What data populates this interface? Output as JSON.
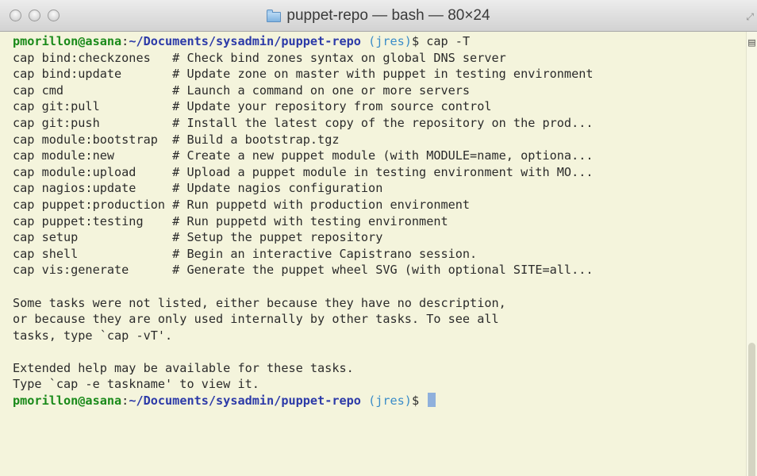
{
  "window": {
    "title": "puppet-repo — bash — 80×24",
    "icons": {
      "folder": "folder-icon",
      "resize": "resize-icon"
    }
  },
  "terminal": {
    "command_prompt": {
      "user_host": "pmorillon@asana",
      "sep": ":",
      "path": "~/Documents/sysadmin/puppet-repo",
      "branch": " (jres)",
      "symbol": "$",
      "command": " cap -T"
    },
    "tasks": [
      {
        "cmd": "cap bind:checkzones   ",
        "desc": "# Check bind zones syntax on global DNS server"
      },
      {
        "cmd": "cap bind:update       ",
        "desc": "# Update zone on master with puppet in testing environment"
      },
      {
        "cmd": "cap cmd               ",
        "desc": "# Launch a command on one or more servers"
      },
      {
        "cmd": "cap git:pull          ",
        "desc": "# Update your repository from source control"
      },
      {
        "cmd": "cap git:push          ",
        "desc": "# Install the latest copy of the repository on the prod..."
      },
      {
        "cmd": "cap module:bootstrap  ",
        "desc": "# Build a bootstrap.tgz"
      },
      {
        "cmd": "cap module:new        ",
        "desc": "# Create a new puppet module (with MODULE=name, optiona..."
      },
      {
        "cmd": "cap module:upload     ",
        "desc": "# Upload a puppet module in testing environment with MO..."
      },
      {
        "cmd": "cap nagios:update     ",
        "desc": "# Update nagios configuration"
      },
      {
        "cmd": "cap puppet:production ",
        "desc": "# Run puppetd with production environment"
      },
      {
        "cmd": "cap puppet:testing    ",
        "desc": "# Run puppetd with testing environment"
      },
      {
        "cmd": "cap setup             ",
        "desc": "# Setup the puppet repository"
      },
      {
        "cmd": "cap shell             ",
        "desc": "# Begin an interactive Capistrano session."
      },
      {
        "cmd": "cap vis:generate      ",
        "desc": "# Generate the puppet wheel SVG (with optional SITE=all..."
      }
    ],
    "notice_lines": [
      "Some tasks were not listed, either because they have no description,",
      "or because they are only used internally by other tasks. To see all",
      "tasks, type `cap -vT'."
    ],
    "help_lines": [
      "Extended help may be available for these tasks.",
      "Type `cap -e taskname' to view it."
    ],
    "final_prompt": {
      "user_host": "pmorillon@asana",
      "sep": ":",
      "path": "~/Documents/sysadmin/puppet-repo",
      "branch": " (jres)",
      "symbol": "$",
      "command": " "
    }
  },
  "colors": {
    "background": "#f4f4dc",
    "user_host": "#1a8a1a",
    "path": "#2c3aa8",
    "branch": "#3a8cc8",
    "cursor": "#8fb0dc"
  }
}
